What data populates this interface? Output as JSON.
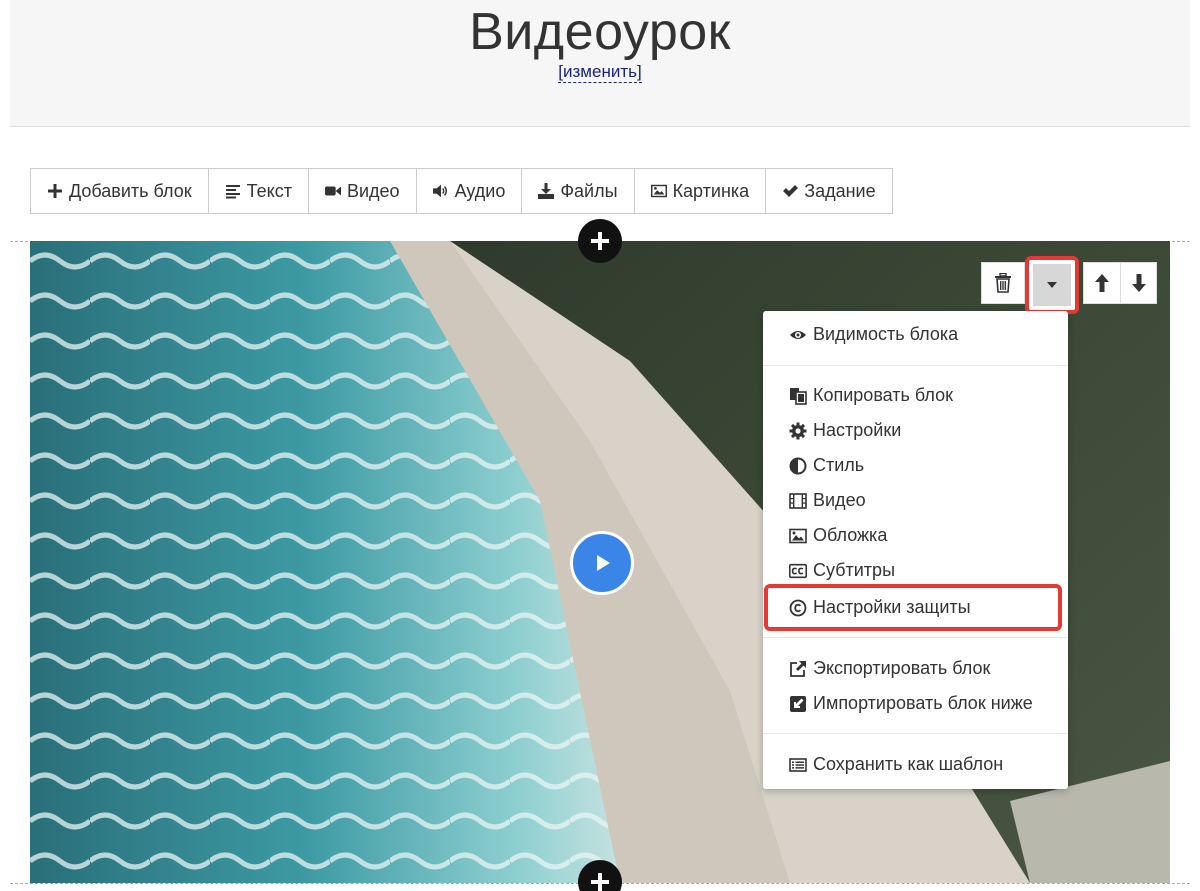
{
  "header": {
    "title": "Видеоурок",
    "edit_link": "[изменить]"
  },
  "toolbar": {
    "buttons": [
      {
        "label": "Добавить блок",
        "icon": "plus-icon"
      },
      {
        "label": "Текст",
        "icon": "text-align-icon"
      },
      {
        "label": "Видео",
        "icon": "video-camera-icon"
      },
      {
        "label": "Аудио",
        "icon": "volume-icon"
      },
      {
        "label": "Файлы",
        "icon": "download-icon"
      },
      {
        "label": "Картинка",
        "icon": "image-icon"
      },
      {
        "label": "Задание",
        "icon": "check-icon"
      }
    ]
  },
  "block_controls": {
    "icons": [
      "trash-icon",
      "caret-down-icon",
      "arrow-up-icon",
      "arrow-down-icon"
    ]
  },
  "dropdown_menu": {
    "items": [
      {
        "label": "Видимость блока",
        "icon": "eye-icon"
      },
      {
        "label": "Копировать блок",
        "icon": "copy-icon"
      },
      {
        "label": "Настройки",
        "icon": "gear-icon"
      },
      {
        "label": "Стиль",
        "icon": "adjust-icon"
      },
      {
        "label": "Видео",
        "icon": "film-icon"
      },
      {
        "label": "Обложка",
        "icon": "picture-icon"
      },
      {
        "label": "Субтитры",
        "icon": "cc-icon"
      },
      {
        "label": "Настройки защиты",
        "icon": "copyright-icon"
      },
      {
        "label": "Экспортировать блок",
        "icon": "external-link-icon"
      },
      {
        "label": "Импортировать блок ниже",
        "icon": "import-icon"
      },
      {
        "label": "Сохранить как шаблон",
        "icon": "list-icon"
      }
    ],
    "highlighted_item": "Настройки защиты"
  },
  "colors": {
    "highlight": "#e53935",
    "play_button": "#3a86e8",
    "link": "#1a237e"
  }
}
